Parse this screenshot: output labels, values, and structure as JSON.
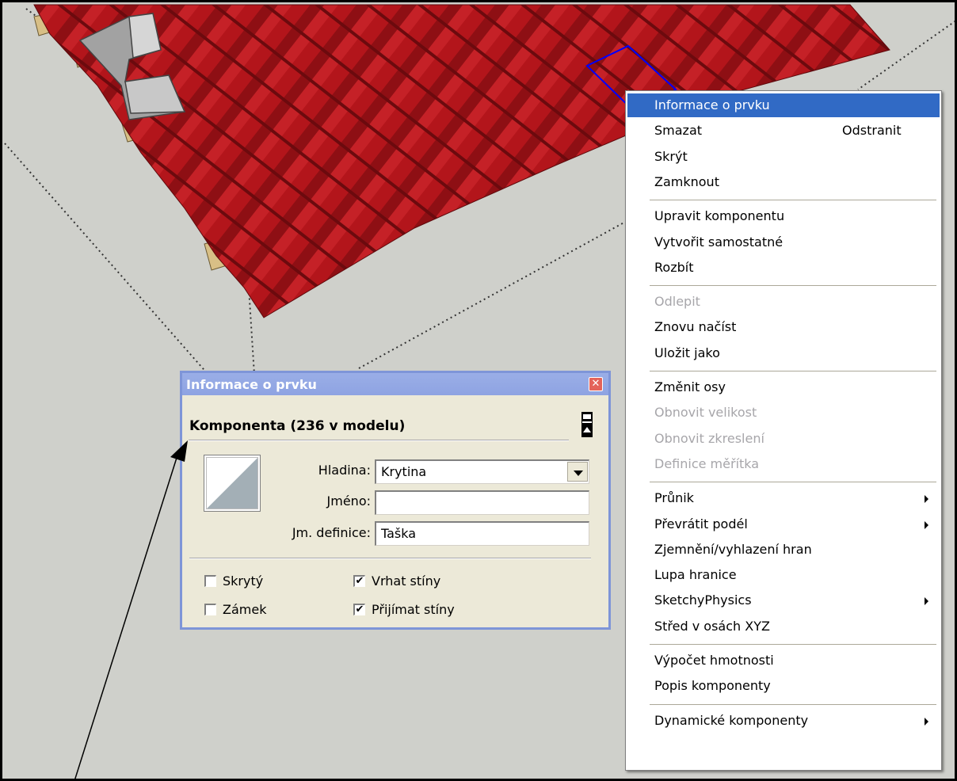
{
  "entity_info_dialog": {
    "title": "Informace o prvku",
    "close_icon": "close-x-icon",
    "heading": "Komponenta (236 v modelu)",
    "toggle_icon": "collapse-toggle-icon",
    "preview_icon": "component-preview-icon",
    "fields": {
      "layer": {
        "label": "Hladina:",
        "value": "Krytina"
      },
      "name": {
        "label": "Jméno:",
        "value": ""
      },
      "definition_name": {
        "label": "Jm. definice:",
        "value": "Taška"
      }
    },
    "checkboxes": {
      "hidden": {
        "label": "Skrytý",
        "checked": false
      },
      "locked": {
        "label": "Zámek",
        "checked": false
      },
      "cast_shadows": {
        "label": "Vrhat stíny",
        "checked": true
      },
      "receive_shadows": {
        "label": "Přijímat stíny",
        "checked": true
      }
    },
    "checkmark": "✔"
  },
  "context_menu": {
    "items": [
      {
        "label": "Informace o prvku",
        "selected": true
      },
      {
        "label": "Smazat",
        "shortcut": "Odstranit"
      },
      {
        "label": "Skrýt"
      },
      {
        "label": "Zamknout"
      },
      {
        "separator": true
      },
      {
        "label": "Upravit komponentu"
      },
      {
        "label": "Vytvořit samostatné"
      },
      {
        "label": "Rozbít"
      },
      {
        "separator": true
      },
      {
        "label": "Odlepit",
        "disabled": true
      },
      {
        "label": "Znovu načíst"
      },
      {
        "label": "Uložit jako"
      },
      {
        "separator": true
      },
      {
        "label": "Změnit osy"
      },
      {
        "label": "Obnovit velikost",
        "disabled": true
      },
      {
        "label": "Obnovit zkreslení",
        "disabled": true
      },
      {
        "label": "Definice měřítka",
        "disabled": true
      },
      {
        "separator": true
      },
      {
        "label": "Průnik",
        "submenu": true
      },
      {
        "label": "Převrátit podél",
        "submenu": true
      },
      {
        "label": "Zjemnění/vyhlazení hran"
      },
      {
        "label": "Lupa hranice"
      },
      {
        "label": "SketchyPhysics",
        "submenu": true
      },
      {
        "label": "Střed v osách XYZ"
      },
      {
        "separator": true
      },
      {
        "label": "Výpočet hmotnosti"
      },
      {
        "label": "Popis komponenty"
      },
      {
        "separator": true
      },
      {
        "label": "Dynamické komponenty",
        "submenu": true
      }
    ]
  },
  "colors": {
    "roof_tile": "#b3151b",
    "roof_tile_shade": "#8e0f14",
    "viewport_bg": "#cfd0cb",
    "menu_highlight": "#316ac5",
    "dialog_title": "#8ea3e2",
    "selection_outline": "#0000ff"
  }
}
